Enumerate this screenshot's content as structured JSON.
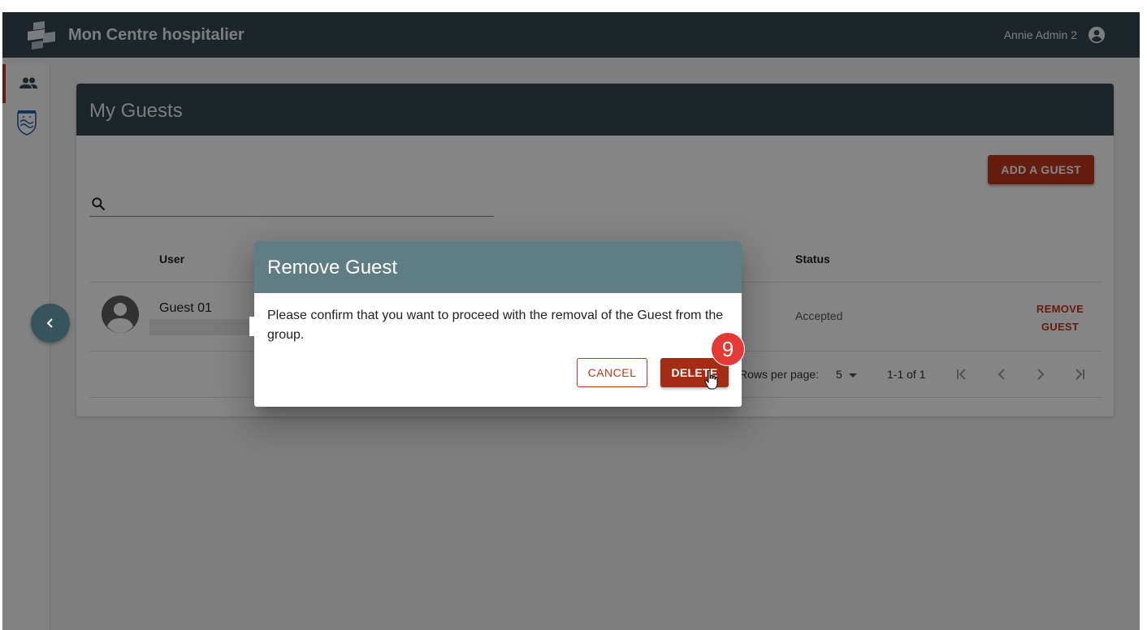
{
  "app": {
    "title": "Mon Centre hospitalier",
    "user_name": "Annie Admin 2"
  },
  "sidebar": {
    "items": [
      {
        "icon": "people-icon",
        "active": true
      },
      {
        "icon": "philips-shield-icon",
        "active": false
      }
    ]
  },
  "page": {
    "title": "My Guests",
    "add_button": "ADD A GUEST",
    "table": {
      "columns": [
        "User",
        "Status"
      ],
      "rows": [
        {
          "name": "Guest 01",
          "status": "Accepted",
          "action": "REMOVE GUEST"
        }
      ]
    },
    "pagination": {
      "rows_label": "Rows per page:",
      "rows_value": "5",
      "range": "1-1 of 1"
    }
  },
  "dialog": {
    "title": "Remove Guest",
    "message": "Please confirm that you want to proceed with the removal of the Guest from the group.",
    "cancel_label": "CANCEL",
    "delete_label": "DELETE"
  },
  "annotation": {
    "step": "9"
  },
  "colors": {
    "topbar": "#37474f",
    "accent": "#c0391b",
    "dialog_header": "#607d84",
    "badge": "#e53935"
  }
}
